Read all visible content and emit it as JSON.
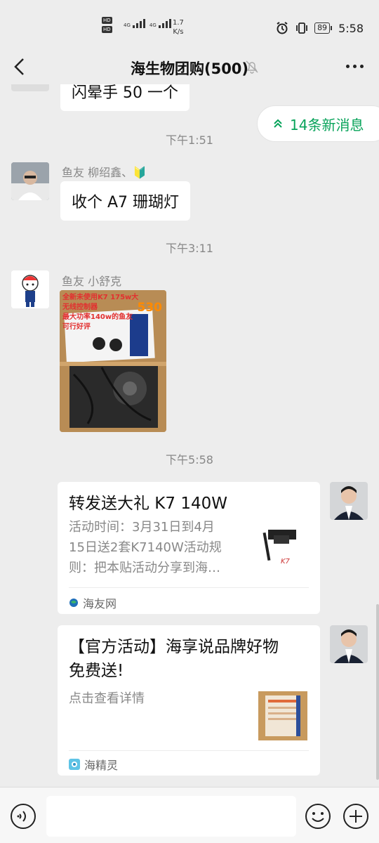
{
  "status_bar": {
    "hd1": "HD",
    "hd2": "HD",
    "net1": "4G",
    "net2": "4G",
    "speed_value": "1.7",
    "speed_unit": "K/s",
    "battery": "89",
    "time": "5:58",
    "icons": [
      "alarm-icon",
      "vibrate-icon",
      "battery-icon",
      "signal-icon"
    ]
  },
  "header": {
    "title": "海生物团购(500)",
    "icons": [
      "back-icon",
      "mute-bell-icon",
      "more-icon"
    ]
  },
  "new_messages": {
    "label": "14条新消息",
    "icon": "double-chevron-up-icon"
  },
  "messages": [
    {
      "type": "text",
      "sender": "",
      "text": "闪晕手 50 一个",
      "partial": true
    },
    {
      "type": "time",
      "text": "下午1:51"
    },
    {
      "type": "text",
      "sender": "鱼友 柳绍鑫、🔰",
      "text": "收个 A7 珊瑚灯"
    },
    {
      "type": "time",
      "text": "下午3:11"
    },
    {
      "type": "image",
      "sender": "鱼友 小舒克",
      "overlay_text": [
        "全新未使用K7 175w大",
        "无线控制器",
        "530",
        "最大功率140w的鱼友",
        "可行好评"
      ]
    },
    {
      "type": "time",
      "text": "下午5:58"
    },
    {
      "type": "card",
      "title": "转发送大礼 K7 140W",
      "desc_lines": [
        "活动时间：3月31日到4月",
        "15日送2套K7140W活动规",
        "则：把本贴活动分享到海…"
      ],
      "thumb_caption": "K7",
      "source": "海友网",
      "source_icon": "globe-icon"
    },
    {
      "type": "card",
      "title_lines": [
        "【官方活动】海享说品牌好物",
        "免费送!"
      ],
      "desc_lines": [
        "点击查看详情"
      ],
      "source": "海精灵",
      "source_icon": "app-icon"
    }
  ],
  "input_bar": {
    "placeholder": "",
    "icons": [
      "voice-icon",
      "emoji-icon",
      "plus-icon"
    ]
  },
  "colors": {
    "background": "#ededed",
    "bubble": "#ffffff",
    "accent_green": "#07a35a",
    "timestamp": "#888888"
  }
}
